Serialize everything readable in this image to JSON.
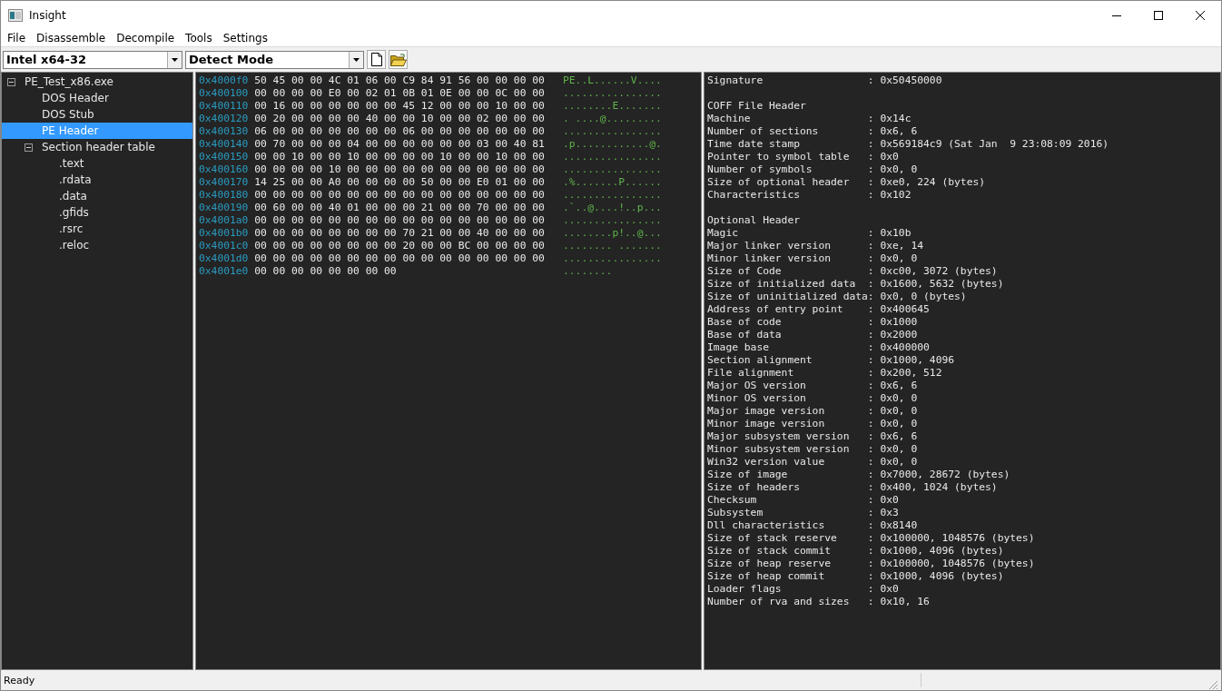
{
  "window": {
    "title": "Insight"
  },
  "menu": [
    "File",
    "Disassemble",
    "Decompile",
    "Tools",
    "Settings"
  ],
  "toolbar": {
    "arch_select": {
      "value": "Intel x64-32"
    },
    "mode_select": {
      "value": "Detect Mode"
    }
  },
  "tree": [
    {
      "label": "PE_Test_x86.exe",
      "expanded": true,
      "selected": false,
      "children": [
        {
          "label": "DOS Header",
          "selected": false
        },
        {
          "label": "DOS Stub",
          "selected": false
        },
        {
          "label": "PE Header",
          "selected": true
        },
        {
          "label": "Section header table",
          "expanded": true,
          "selected": false,
          "children": [
            {
              "label": ".text",
              "selected": false
            },
            {
              "label": ".rdata",
              "selected": false
            },
            {
              "label": ".data",
              "selected": false
            },
            {
              "label": ".gfids",
              "selected": false
            },
            {
              "label": ".rsrc",
              "selected": false
            },
            {
              "label": ".reloc",
              "selected": false
            }
          ]
        }
      ]
    }
  ],
  "hex_rows": [
    {
      "address": "0x4000f0",
      "bytes": "50 45 00 00 4C 01 06 00 C9 84 91 56 00 00 00 00",
      "ascii": "PE..L......V...."
    },
    {
      "address": "0x400100",
      "bytes": "00 00 00 00 E0 00 02 01 0B 01 0E 00 00 0C 00 00",
      "ascii": "................"
    },
    {
      "address": "0x400110",
      "bytes": "00 16 00 00 00 00 00 00 45 12 00 00 00 10 00 00",
      "ascii": "........E......."
    },
    {
      "address": "0x400120",
      "bytes": "00 20 00 00 00 00 40 00 00 10 00 00 02 00 00 00",
      "ascii": ". ....@........."
    },
    {
      "address": "0x400130",
      "bytes": "06 00 00 00 00 00 00 00 06 00 00 00 00 00 00 00",
      "ascii": "................"
    },
    {
      "address": "0x400140",
      "bytes": "00 70 00 00 00 04 00 00 00 00 00 00 03 00 40 81",
      "ascii": ".p............@."
    },
    {
      "address": "0x400150",
      "bytes": "00 00 10 00 00 10 00 00 00 00 10 00 00 10 00 00",
      "ascii": "................"
    },
    {
      "address": "0x400160",
      "bytes": "00 00 00 00 10 00 00 00 00 00 00 00 00 00 00 00",
      "ascii": "................"
    },
    {
      "address": "0x400170",
      "bytes": "14 25 00 00 A0 00 00 00 00 50 00 00 E0 01 00 00",
      "ascii": ".%.......P......"
    },
    {
      "address": "0x400180",
      "bytes": "00 00 00 00 00 00 00 00 00 00 00 00 00 00 00 00",
      "ascii": "................"
    },
    {
      "address": "0x400190",
      "bytes": "00 60 00 00 40 01 00 00 00 21 00 00 70 00 00 00",
      "ascii": ".`..@....!..p..."
    },
    {
      "address": "0x4001a0",
      "bytes": "00 00 00 00 00 00 00 00 00 00 00 00 00 00 00 00",
      "ascii": "................"
    },
    {
      "address": "0x4001b0",
      "bytes": "00 00 00 00 00 00 00 00 70 21 00 00 40 00 00 00",
      "ascii": "........p!..@..."
    },
    {
      "address": "0x4001c0",
      "bytes": "00 00 00 00 00 00 00 00 20 00 00 BC 00 00 00 00",
      "ascii": "........ ......."
    },
    {
      "address": "0x4001d0",
      "bytes": "00 00 00 00 00 00 00 00 00 00 00 00 00 00 00 00",
      "ascii": "................"
    },
    {
      "address": "0x4001e0",
      "bytes": "00 00 00 00 00 00 00 00",
      "ascii": "........"
    }
  ],
  "sections": [
    {
      "fields": [
        {
          "name": "Signature",
          "value": ": 0x50450000"
        }
      ]
    },
    {
      "title": "COFF File Header",
      "fields": [
        {
          "name": "Machine",
          "value": ": 0x14c"
        },
        {
          "name": "Number of sections",
          "value": ": 0x6, 6"
        },
        {
          "name": "Time date stamp",
          "value": ": 0x569184c9 (Sat Jan  9 23:08:09 2016)"
        },
        {
          "name": "Pointer to symbol table",
          "value": ": 0x0"
        },
        {
          "name": "Number of symbols",
          "value": ": 0x0, 0"
        },
        {
          "name": "Size of optional header",
          "value": ": 0xe0, 224 (bytes)"
        },
        {
          "name": "Characteristics",
          "value": ": 0x102"
        }
      ]
    },
    {
      "title": "Optional Header",
      "fields": [
        {
          "name": "Magic",
          "value": ": 0x10b"
        },
        {
          "name": "Major linker version",
          "value": ": 0xe, 14"
        },
        {
          "name": "Minor linker version",
          "value": ": 0x0, 0"
        },
        {
          "name": "Size of Code",
          "value": ": 0xc00, 3072 (bytes)"
        },
        {
          "name": "Size of initialized data",
          "value": ": 0x1600, 5632 (bytes)"
        },
        {
          "name": "Size of uninitialized data",
          "value": ": 0x0, 0 (bytes)"
        },
        {
          "name": "Address of entry point",
          "value": ": 0x400645"
        },
        {
          "name": "Base of code",
          "value": ": 0x1000"
        },
        {
          "name": "Base of data",
          "value": ": 0x2000"
        },
        {
          "name": "Image base",
          "value": ": 0x400000"
        },
        {
          "name": "Section alignment",
          "value": ": 0x1000, 4096"
        },
        {
          "name": "File alignment",
          "value": ": 0x200, 512"
        },
        {
          "name": "Major OS version",
          "value": ": 0x6, 6"
        },
        {
          "name": "Minor OS version",
          "value": ": 0x0, 0"
        },
        {
          "name": "Major image version",
          "value": ": 0x0, 0"
        },
        {
          "name": "Minor image version",
          "value": ": 0x0, 0"
        },
        {
          "name": "Major subsystem version",
          "value": ": 0x6, 6"
        },
        {
          "name": "Minor subsystem version",
          "value": ": 0x0, 0"
        },
        {
          "name": "Win32 version value",
          "value": ": 0x0, 0"
        },
        {
          "name": "Size of image",
          "value": ": 0x7000, 28672 (bytes)"
        },
        {
          "name": "Size of headers",
          "value": ": 0x400, 1024 (bytes)"
        },
        {
          "name": "Checksum",
          "value": ": 0x0"
        },
        {
          "name": "Subsystem",
          "value": ": 0x3"
        },
        {
          "name": "Dll characteristics",
          "value": ": 0x8140"
        },
        {
          "name": "Size of stack reserve",
          "value": ": 0x100000, 1048576 (bytes)"
        },
        {
          "name": "Size of stack commit",
          "value": ": 0x1000, 4096 (bytes)"
        },
        {
          "name": "Size of heap reserve",
          "value": ": 0x100000, 1048576 (bytes)"
        },
        {
          "name": "Size of heap commit",
          "value": ": 0x1000, 4096 (bytes)"
        },
        {
          "name": "Loader flags",
          "value": ": 0x0"
        },
        {
          "name": "Number of rva and sizes",
          "value": ": 0x10, 16"
        }
      ]
    }
  ],
  "status_bar": {
    "message": "Ready"
  }
}
